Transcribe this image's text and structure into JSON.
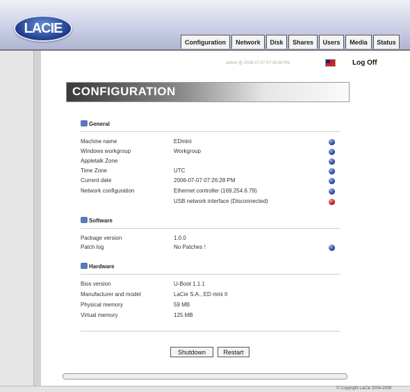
{
  "logo": "LACIE",
  "tabs": [
    "Configuration",
    "Network",
    "Disk",
    "Shares",
    "Users",
    "Media",
    "Status"
  ],
  "user_info": "admin @ 2006-07-07 07:28:39 PM",
  "logoff": "Log Off",
  "page_title": "CONFIGURATION",
  "general": {
    "title": "General",
    "rows": [
      {
        "label": "Machine name",
        "value": "EDmini"
      },
      {
        "label": "Windows workgroup",
        "value": "Workgroup"
      },
      {
        "label": "Appletalk Zone",
        "value": ""
      },
      {
        "label": "Time Zone",
        "value": "UTC"
      },
      {
        "label": "Current date",
        "value": "2006-07-07 07:26:28 PM"
      },
      {
        "label": "Network configuration",
        "value": "Ethernet controller (169.254.6.79)"
      },
      {
        "label": "",
        "value": "USB network interface (Disconnected)"
      }
    ]
  },
  "software": {
    "title": "Software",
    "rows": [
      {
        "label": "Package version",
        "value": "1.0.0"
      },
      {
        "label": "Patch log",
        "value": "No Patches !"
      }
    ]
  },
  "hardware": {
    "title": "Hardware",
    "rows": [
      {
        "label": "Bios version",
        "value": "U-Boot 1.1.1"
      },
      {
        "label": "Manufacturer and model",
        "value": "LaCie S.A., ED mini II"
      },
      {
        "label": "Physical memory",
        "value": "59 MB"
      },
      {
        "label": "Virtual memory",
        "value": "125 MB"
      }
    ]
  },
  "buttons": {
    "shutdown": "Shutdown",
    "restart": "Restart"
  },
  "copyright": "© Copyright LaCie 2004-2006"
}
